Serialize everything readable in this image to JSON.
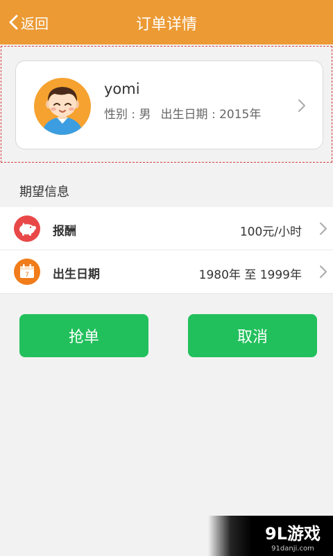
{
  "header": {
    "back_label": "返回",
    "title": "订单详情",
    "background_color": "#ec9a34"
  },
  "profile": {
    "name": "yomi",
    "gender_label": "性别 : 男",
    "birth_label": "出生日期 : 2015年",
    "avatar_icon": "boy-avatar-icon"
  },
  "section": {
    "title": "期望信息"
  },
  "rows": [
    {
      "label": "报酬",
      "value": "100元/小时",
      "icon": "piggy-bank-icon",
      "icon_color": "#e94848"
    },
    {
      "label": "出生日期",
      "value": "1980年 至 1999年",
      "icon": "calendar-icon",
      "icon_color": "#f07c1a"
    }
  ],
  "actions": {
    "grab_label": "抢单",
    "cancel_label": "取消",
    "button_color": "#22c05c"
  },
  "watermark": {
    "brand": "9L游戏",
    "domain": "91danji.com"
  }
}
